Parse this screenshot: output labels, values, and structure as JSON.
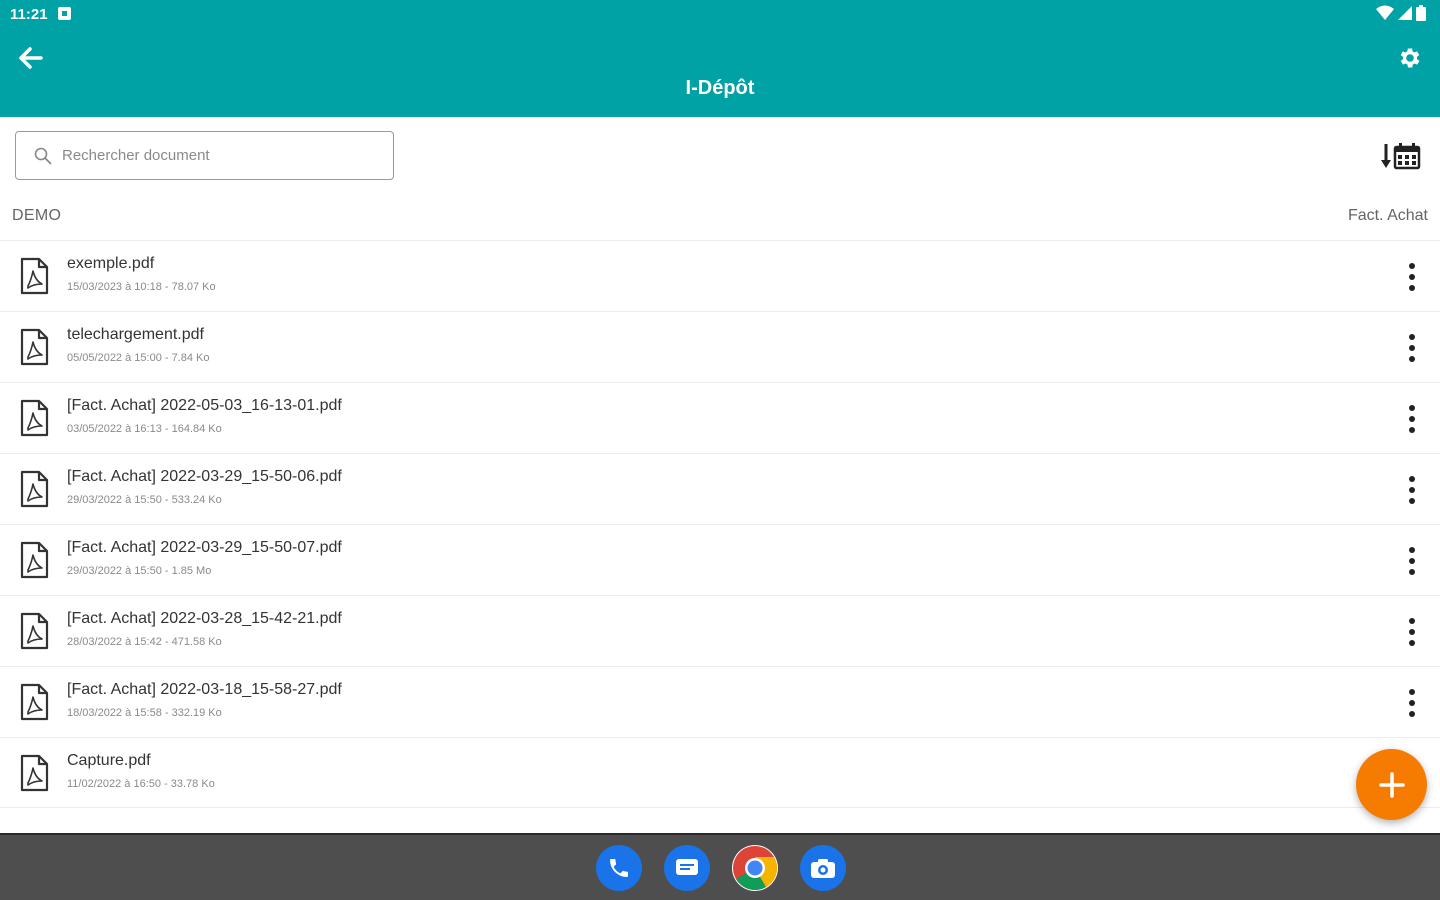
{
  "status_bar": {
    "time": "11:21"
  },
  "app_bar": {
    "title": "I-Dépôt"
  },
  "search": {
    "placeholder": "Rechercher document"
  },
  "section": {
    "left_label": "DEMO",
    "right_label": "Fact. Achat"
  },
  "files": [
    {
      "name": "exemple.pdf",
      "meta": "15/03/2023 à 10:18 - 78.07 Ko"
    },
    {
      "name": "telechargement.pdf",
      "meta": "05/05/2022 à 15:00 - 7.84 Ko"
    },
    {
      "name": "[Fact. Achat] 2022-05-03_16-13-01.pdf",
      "meta": "03/05/2022 à 16:13 - 164.84 Ko"
    },
    {
      "name": "[Fact. Achat] 2022-03-29_15-50-06.pdf",
      "meta": "29/03/2022 à 15:50 - 533.24 Ko"
    },
    {
      "name": "[Fact. Achat] 2022-03-29_15-50-07.pdf",
      "meta": "29/03/2022 à 15:50 - 1.85 Mo"
    },
    {
      "name": "[Fact. Achat] 2022-03-28_15-42-21.pdf",
      "meta": "28/03/2022 à 15:42 - 471.58 Ko"
    },
    {
      "name": "[Fact. Achat] 2022-03-18_15-58-27.pdf",
      "meta": "18/03/2022 à 15:58 - 332.19 Ko"
    },
    {
      "name": "Capture.pdf",
      "meta": "11/02/2022 à 16:50 - 33.78 Ko"
    }
  ],
  "icons": {
    "back": "arrow-left-icon",
    "settings": "gear-icon",
    "search": "search-icon",
    "sort": "sort-by-date-icon",
    "file": "pdf-file-icon",
    "more": "more-vertical-icon",
    "fab": "plus-icon",
    "dock": [
      "phone-icon",
      "messages-icon",
      "chrome-icon",
      "camera-icon"
    ]
  },
  "colors": {
    "primary": "#00a2a5",
    "accent": "#f57c00",
    "navbar": "#4e4e4e"
  }
}
